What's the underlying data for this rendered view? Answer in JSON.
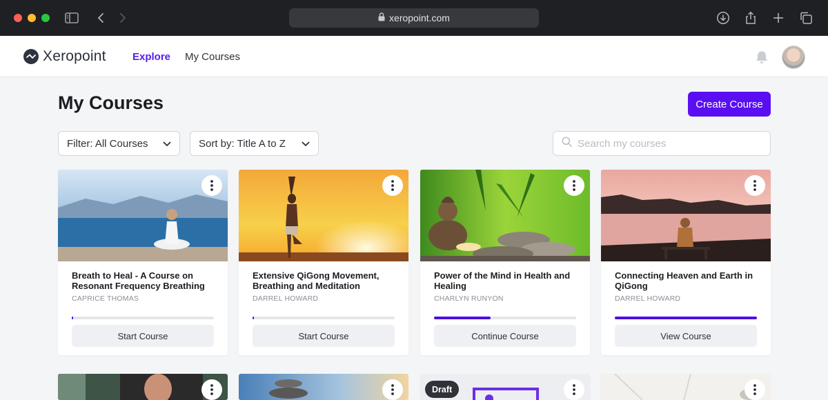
{
  "browser": {
    "url": "xeropoint.com"
  },
  "nav": {
    "brand": "Xeropoint",
    "links": [
      {
        "label": "Explore",
        "active": true
      },
      {
        "label": "My Courses",
        "active": false
      }
    ]
  },
  "header": {
    "title": "My Courses",
    "create_label": "Create Course"
  },
  "toolbar": {
    "filter_label": "Filter: All Courses",
    "sort_label": "Sort by: Title A to Z",
    "search_placeholder": "Search my courses"
  },
  "colors": {
    "accent": "#5a0ff2",
    "progress": "#4c0fe0"
  },
  "courses": [
    {
      "title": "Breath to Heal - A Course on Resonant Frequency Breathing",
      "author": "CAPRICE THOMAS",
      "progress": 0.01,
      "action": "Start Course"
    },
    {
      "title": "Extensive QiGong Movement, Breathing and Meditation",
      "author": "DARREL HOWARD",
      "progress": 0.01,
      "action": "Start Course"
    },
    {
      "title": "Power of the Mind in Health and Healing",
      "author": "CHARLYN RUNYON",
      "progress": 0.4,
      "action": "Continue Course"
    },
    {
      "title": "Connecting Heaven and Earth in QiGong",
      "author": "DARREL HOWARD",
      "progress": 1.0,
      "action": "View Course"
    }
  ],
  "second_row": {
    "draft_label": "Draft"
  }
}
